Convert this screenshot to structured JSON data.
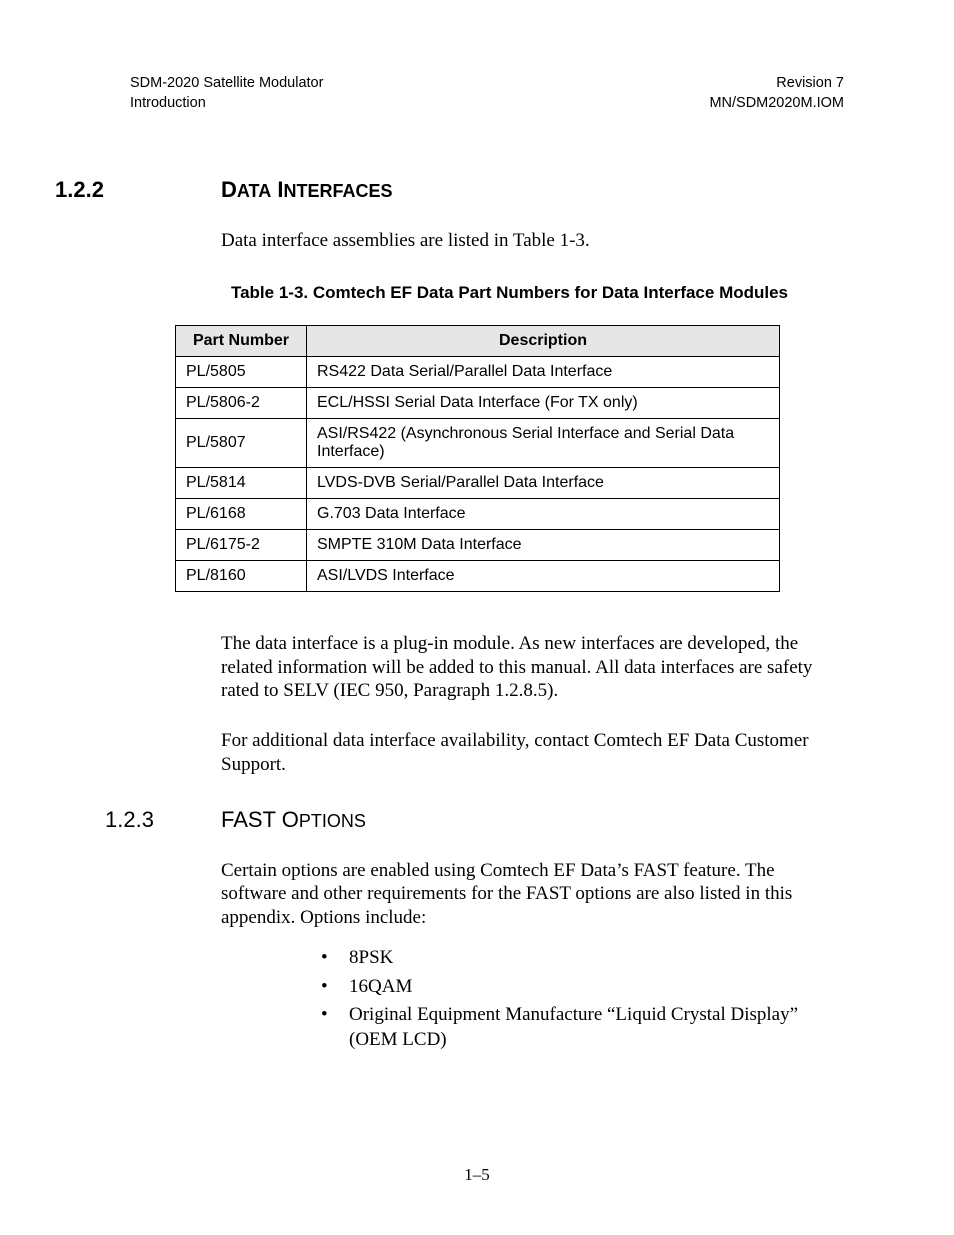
{
  "header": {
    "left_line1": "SDM-2020 Satellite Modulator",
    "left_line2": "Introduction",
    "right_line1": "Revision 7",
    "right_line2": "MN/SDM2020M.IOM"
  },
  "section_122": {
    "number": "1.2.2",
    "title_word1": "D",
    "title_rest1": "ATA",
    "title_word2": "I",
    "title_rest2": "NTERFACES",
    "intro": "Data interface assemblies are listed in Table 1-3.",
    "table_caption": "Table 1-3.  Comtech EF Data Part Numbers for Data Interface Modules",
    "table_headers": {
      "col1": "Part Number",
      "col2": "Description"
    },
    "rows": [
      {
        "pn": "PL/5805",
        "desc": "RS422 Data Serial/Parallel Data Interface"
      },
      {
        "pn": "PL/5806-2",
        "desc": "ECL/HSSI Serial Data Interface (For TX only)"
      },
      {
        "pn": "PL/5807",
        "desc": "ASI/RS422 (Asynchronous Serial Interface and Serial Data Interface)"
      },
      {
        "pn": "PL/5814",
        "desc": "LVDS-DVB Serial/Parallel Data Interface"
      },
      {
        "pn": "PL/6168",
        "desc": "G.703 Data Interface"
      },
      {
        "pn": "PL/6175-2",
        "desc": "SMPTE 310M Data Interface"
      },
      {
        "pn": "PL/8160",
        "desc": "ASI/LVDS Interface"
      }
    ],
    "para2": "The data interface is a plug-in module. As new interfaces are developed, the related information will be added to this manual. All data interfaces are safety rated to SELV (IEC 950, Paragraph 1.2.8.5).",
    "para3": "For additional data interface availability, contact Comtech EF Data Customer Support."
  },
  "section_123": {
    "number": "1.2.3",
    "title_main": "FAST O",
    "title_small": "PTIONS",
    "intro": "Certain options are enabled using Comtech EF Data’s FAST feature. The software and other requirements for the FAST options are also listed in this appendix. Options include:",
    "options": [
      "8PSK",
      "16QAM",
      "Original Equipment Manufacture “Liquid Crystal Display” (OEM LCD)"
    ]
  },
  "page_number": "1–5"
}
